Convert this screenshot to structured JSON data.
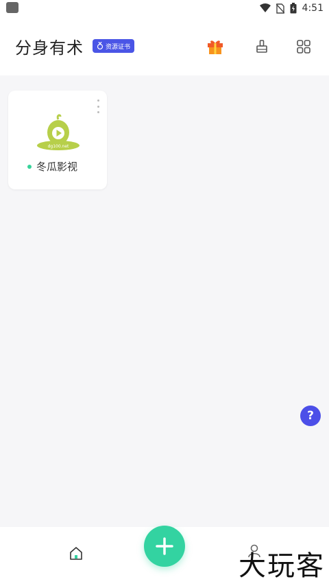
{
  "status_bar": {
    "time": "4:51"
  },
  "header": {
    "title": "分身有术",
    "badge": "资源证书"
  },
  "apps": [
    {
      "name": "冬瓜影视",
      "logo_text": "dg100.net",
      "status_color": "#37d39a"
    }
  ],
  "icons": {
    "status_left": "app-notification-icon",
    "status": [
      "wifi-icon",
      "no-sim-icon",
      "battery-icon"
    ],
    "header_actions": [
      "gift-icon",
      "clean-brush-icon",
      "grid-icon"
    ],
    "nav": [
      "home-icon",
      "add-icon",
      "profile-icon"
    ],
    "help": "help-icon"
  },
  "help_label": "?",
  "watermark": "大玩客",
  "colors": {
    "accent": "#4a55e6",
    "add_button": "#33d3a1",
    "help_button": "#4c4fe8",
    "gift": "#f05a28"
  }
}
